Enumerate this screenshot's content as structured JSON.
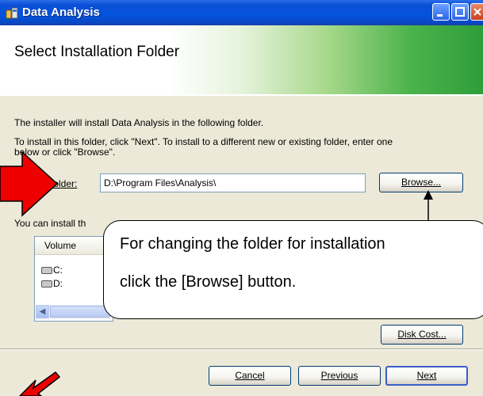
{
  "window": {
    "title": "Data Analysis"
  },
  "banner": {
    "title": "Select Installation Folder"
  },
  "body": {
    "intro": "The installer will install Data Analysis in the following folder.",
    "instructions_line1": "To install in this folder, click \"Next\". To install to a different new or existing folder, enter one",
    "instructions_line2": "below or click \"Browse\".",
    "folder_label": "Folder:",
    "folder_value": "D:\\Program Files\\Analysis\\",
    "browse_label": "Browse...",
    "install_note_partial": "You can install th",
    "disk_cost_label": "Disk Cost..."
  },
  "volumes": {
    "header": "Volume",
    "items": [
      "C:",
      "D:"
    ]
  },
  "footer": {
    "cancel_label": "Cancel",
    "previous_label": "Previous",
    "next_label": "Next"
  },
  "callout": {
    "line1": "For changing the folder for installation",
    "line2": "click the [Browse] button."
  },
  "colors": {
    "titlebar": "#0553dc",
    "banner_green": "#2e9e3a",
    "arrow_red": "#ee0000",
    "dialog_bg": "#ece9d8"
  }
}
